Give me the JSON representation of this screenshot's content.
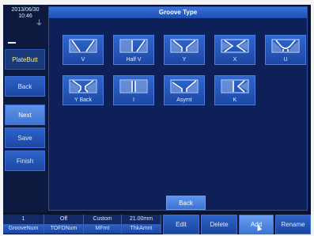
{
  "status": {
    "date": "2013/06/30",
    "time": "10:46",
    "icon": "plug-icon"
  },
  "sidebar": {
    "mode_label": "PlateButt",
    "buttons": [
      "Back",
      "Next",
      "Save",
      "Finish"
    ],
    "active": "Next"
  },
  "panel": {
    "title": "Groove Type",
    "grooves": [
      {
        "label": "V",
        "icon": "groove-v-icon"
      },
      {
        "label": "Half V",
        "icon": "groove-half-v-icon"
      },
      {
        "label": "Y",
        "icon": "groove-y-icon"
      },
      {
        "label": "X",
        "icon": "groove-x-icon"
      },
      {
        "label": "U",
        "icon": "groove-u-icon"
      },
      {
        "label": "Y Back",
        "icon": "groove-y-back-icon"
      },
      {
        "label": "I",
        "icon": "groove-i-icon"
      },
      {
        "label": "Asymt",
        "icon": "groove-asym-icon"
      },
      {
        "label": "K",
        "icon": "groove-k-icon"
      }
    ],
    "back_label": "Back"
  },
  "bottom": {
    "values": [
      "1",
      "Off",
      "Custom",
      "21.00mm"
    ],
    "labels": [
      "GrooveNum",
      "TOFDNum",
      "MFmt",
      "ThkAmnt"
    ],
    "buttons": [
      "Edit",
      "Delete",
      "Add",
      "Rename"
    ],
    "active_button": "Add"
  },
  "colors": {
    "background": "#0a1430",
    "panel": "#0e2058",
    "button": "#1d48a4",
    "accent": "#f2ee7a"
  }
}
